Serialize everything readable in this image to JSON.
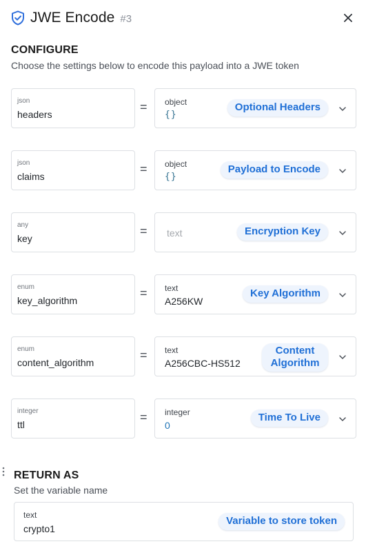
{
  "header": {
    "title": "JWE Encode",
    "number": "#3",
    "icon": "shield-check-icon",
    "close_icon": "close-icon"
  },
  "configure": {
    "title": "CONFIGURE",
    "description": "Choose the settings below to encode this payload into a JWE token"
  },
  "fields": [
    {
      "type": "json",
      "name": "headers",
      "value_type": "object",
      "value": "{}",
      "placeholder": "",
      "label": "Optional Headers"
    },
    {
      "type": "json",
      "name": "claims",
      "value_type": "object",
      "value": "{}",
      "placeholder": "",
      "label": "Payload to Encode"
    },
    {
      "type": "any",
      "name": "key",
      "value_type": "",
      "value": "",
      "placeholder": "text",
      "label": "Encryption Key"
    },
    {
      "type": "enum",
      "name": "key_algorithm",
      "value_type": "text",
      "value": "A256KW",
      "placeholder": "",
      "label": "Key Algorithm"
    },
    {
      "type": "enum",
      "name": "content_algorithm",
      "value_type": "text",
      "value": "A256CBC-HS512",
      "placeholder": "",
      "label_line1": "Content",
      "label_line2": "Algorithm"
    },
    {
      "type": "integer",
      "name": "ttl",
      "value_type": "integer",
      "value": "0",
      "placeholder": "",
      "label": "Time To Live"
    }
  ],
  "equals": "=",
  "return_as": {
    "title": "RETURN AS",
    "description": "Set the variable name",
    "value_type": "text",
    "value": "crypto1",
    "label": "Variable to store token"
  },
  "colors": {
    "accent": "#1f6fd6",
    "badge_bg": "#eef4fd",
    "border": "#dcdfe3",
    "shield": "#2f6fdc"
  }
}
